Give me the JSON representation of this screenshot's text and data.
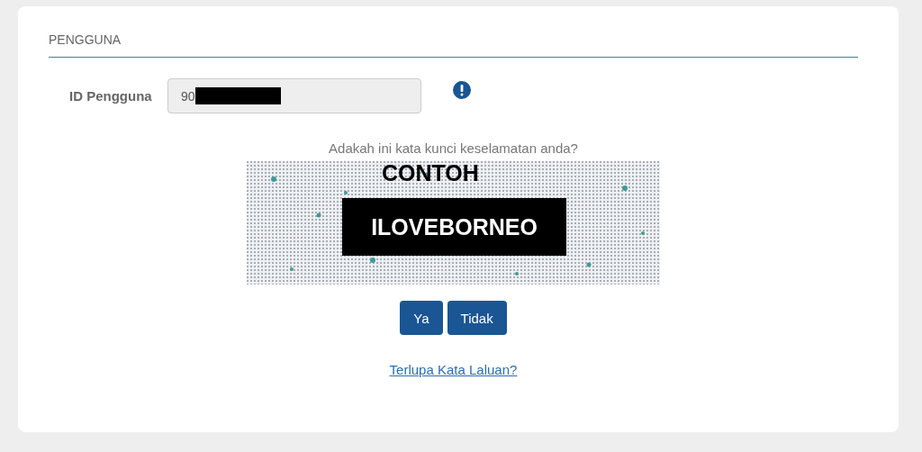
{
  "section": {
    "title": "PENGGUNA"
  },
  "user_id": {
    "label": "ID Pengguna",
    "value": "90",
    "redacted": true
  },
  "question": "Adakah ini kata kunci keselamatan anda?",
  "security_image": {
    "caption": "CONTOH",
    "phrase": "ILOVEBORNEO"
  },
  "buttons": [
    "Ya",
    "Tidak"
  ],
  "link": "Terlupa Kata Laluan?"
}
